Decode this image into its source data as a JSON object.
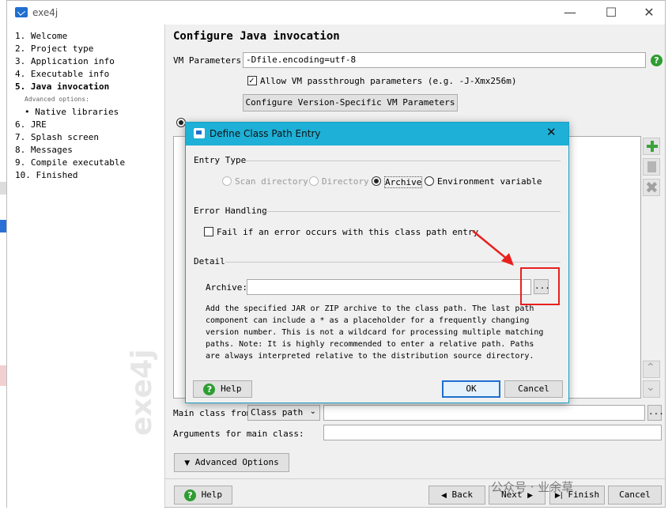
{
  "window": {
    "title": "exe4j"
  },
  "steps": [
    {
      "label": "1. Welcome"
    },
    {
      "label": "2. Project type"
    },
    {
      "label": "3. Application info"
    },
    {
      "label": "4. Executable info"
    },
    {
      "label": "5. Java invocation"
    },
    {
      "label": "Advanced options:"
    },
    {
      "label": "• Native libraries"
    },
    {
      "label": "6. JRE"
    },
    {
      "label": "7. Splash screen"
    },
    {
      "label": "8. Messages"
    },
    {
      "label": "9. Compile executable"
    },
    {
      "label": "10. Finished"
    }
  ],
  "page": {
    "title": "Configure Java invocation",
    "vm_label": "VM Parameters:",
    "vm_value": "-Dfile.encoding=utf-8",
    "passthrough_label": "Allow VM passthrough parameters (e.g. -J-Xmx256m)",
    "version_specific_button": "Configure Version-Specific VM Parameters",
    "main_class_label": "Main class from",
    "main_class_source": "Class path",
    "args_label": "Arguments for main class:",
    "advanced_button": "Advanced Options",
    "browse_button": "...",
    "watermark": "exe4j"
  },
  "footer": {
    "help": "Help",
    "back": "Back",
    "next": "Next",
    "finish": "Finish",
    "cancel": "Cancel",
    "social_text": "公众号 · 业余草"
  },
  "dialog": {
    "title": "Define Class Path Entry",
    "entry_type_heading": "Entry Type",
    "entry_types": [
      {
        "label": "Scan directory",
        "selected": false,
        "enabled": false
      },
      {
        "label": "Directory",
        "selected": false,
        "enabled": false
      },
      {
        "label": "Archive",
        "selected": true,
        "enabled": true
      },
      {
        "label": "Environment variable",
        "selected": false,
        "enabled": true
      }
    ],
    "error_heading": "Error Handling",
    "error_checkbox": "Fail if an error occurs with this class path entry",
    "detail_heading": "Detail",
    "archive_label": "Archive:",
    "archive_value": "",
    "browse_button": "...",
    "description": [
      "Add the specified JAR or ZIP archive to the class path. The last path",
      "component can include a * as a placeholder for a frequently changing",
      "version number. This is not a wildcard for processing multiple matching",
      "paths. Note: It is highly recommended to enter a relative path. Paths",
      "are always interpreted relative to the distribution source directory."
    ],
    "help": "Help",
    "ok": "OK",
    "cancel": "Cancel"
  },
  "colors": {
    "accent": "#1eb0d6",
    "annotation": "#e8201e",
    "help_green": "#2e9d32"
  }
}
